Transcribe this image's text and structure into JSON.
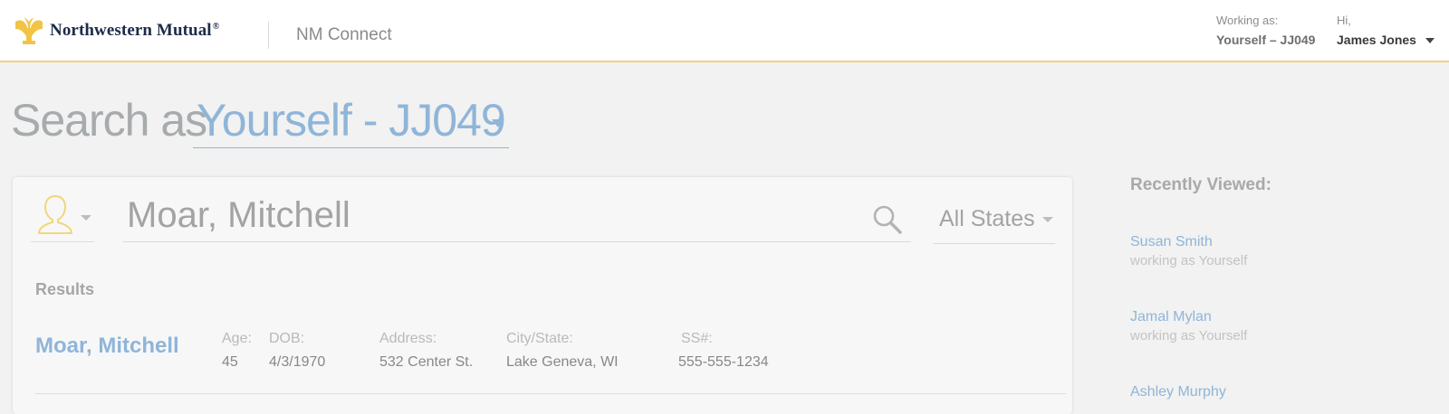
{
  "header": {
    "brand": "Northwestern Mutual",
    "brand_mark": "®",
    "app_name": "NM Connect",
    "working_as_label": "Working as:",
    "working_as_value": "Yourself – JJ049",
    "greeting": "Hi,",
    "user_name": "James Jones"
  },
  "search_as": {
    "label": "Search as",
    "value": "Yourself - JJ049"
  },
  "search": {
    "type_icon": "person-icon",
    "query": "Moar, Mitchell",
    "state": "All States"
  },
  "results": {
    "heading": "Results",
    "rows": [
      {
        "name": "Moar,  Mitchell",
        "age_label": "Age:",
        "age": "45",
        "dob_label": "DOB:",
        "dob": "4/3/1970",
        "address_label": "Address:",
        "address": "532 Center St.",
        "city_label": "City/State:",
        "city": "Lake Geneva, WI",
        "ssn_label": "SS#:",
        "ssn": "555-555-1234"
      }
    ]
  },
  "recent": {
    "heading": "Recently Viewed:",
    "items": [
      {
        "name": "Susan Smith",
        "sub": "working as Yourself"
      },
      {
        "name": "Jamal Mylan",
        "sub": "working as Yourself"
      },
      {
        "name": "Ashley Murphy",
        "sub": ""
      }
    ]
  },
  "colors": {
    "accent_blue": "#8fb5d9",
    "brand_gold": "#f2c446",
    "brand_navy": "#1c2b4a",
    "header_border": "#f3d27a"
  }
}
